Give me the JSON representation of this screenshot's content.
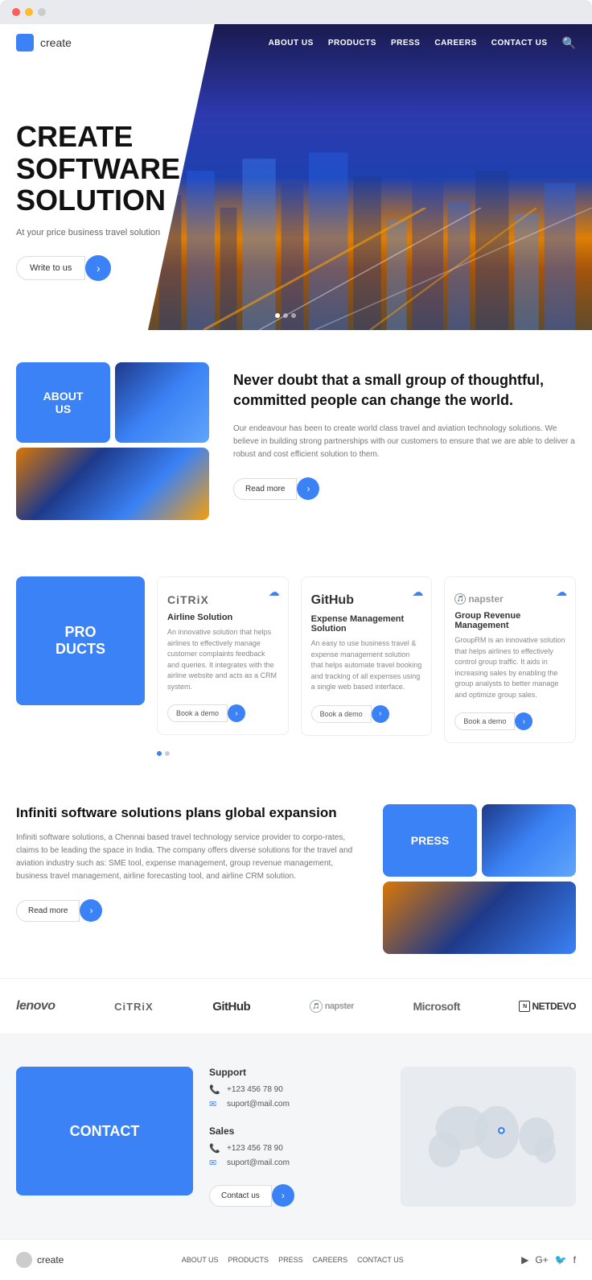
{
  "browser": {
    "dots": [
      "red",
      "yellow",
      "gray"
    ]
  },
  "navbar": {
    "logo_text": "create",
    "links": [
      "ABOUT US",
      "PRODUCTS",
      "PRESS",
      "CAREERS",
      "CONTACT US"
    ]
  },
  "hero": {
    "title": "CREATE SOFTWARE SOLUTION",
    "subtitle": "At your price business travel solution",
    "cta_button": "Write to us",
    "arrow": "›"
  },
  "about": {
    "label": "ABOUT\nUS",
    "quote": "Never doubt that a small group of thoughtful, committed people can change the world.",
    "description": "Our endeavour has been to create world class travel and aviation technology solutions. We believe in building strong partnerships with our customers to ensure that we are able to deliver a robust and cost efficient solution to them.",
    "read_more": "Read more",
    "arrow": "›"
  },
  "products": {
    "label": "PRO\nDUCTS",
    "items": [
      {
        "logo": "CiTRiX",
        "title": "Airline Solution",
        "description": "An innovative solution that helps airlines to effectively manage customer complaints feedback and queries. It integrates with the airline website and acts as a CRM system.",
        "cta": "Book a demo"
      },
      {
        "logo": "GitHub",
        "title": "Expense Management Solution",
        "description": "An easy to use business travel & expense management solution that helps automate travel booking and tracking of all expenses using a single web based interface.",
        "cta": "Book a demo"
      },
      {
        "logo": "napster",
        "title": "Group Revenue Management",
        "description": "GroupRM is an innovative solution that helps airlines to effectively control group traffic. It aids in increasing sales by enabling the group analysts to better manage and optimize group sales.",
        "cta": "Book a demo"
      }
    ],
    "arrow": "›"
  },
  "press": {
    "label": "PRESS",
    "title": "Infiniti software solutions plans global expansion",
    "description": "Infiniti software solutions, a Chennai based travel technology service provider to corpo-rates, claims to be leading the space in India. The company offers diverse solutions for the travel and aviation industry such as: SME tool, expense management, group revenue management, business travel management, airline forecasting tool, and airline CRM solution.",
    "read_more": "Read more",
    "arrow": "›"
  },
  "partners": {
    "logos": [
      "lenovo",
      "CiTRiX",
      "GitHub",
      "napster",
      "Microsoft",
      "NETDEVO"
    ]
  },
  "contact": {
    "label": "CONTACT",
    "support": {
      "title": "Support",
      "phone": "+123 456 78 90",
      "email": "suport@mail.com"
    },
    "sales": {
      "title": "Sales",
      "phone": "+123 456 78 90",
      "email": "suport@mail.com"
    },
    "cta_button": "Contact us",
    "arrow": "›"
  },
  "footer": {
    "logo_text": "create",
    "links": [
      "ABOUT US",
      "PRODUCTS",
      "PRESS",
      "CAREERS",
      "CONTACT US"
    ],
    "social": [
      "▶",
      "G+",
      "🐦",
      "f"
    ]
  },
  "icons": {
    "arrow_right": "›",
    "search": "🔍",
    "phone": "📞",
    "email": "✉",
    "cloud": "☁",
    "pin": "📍"
  }
}
